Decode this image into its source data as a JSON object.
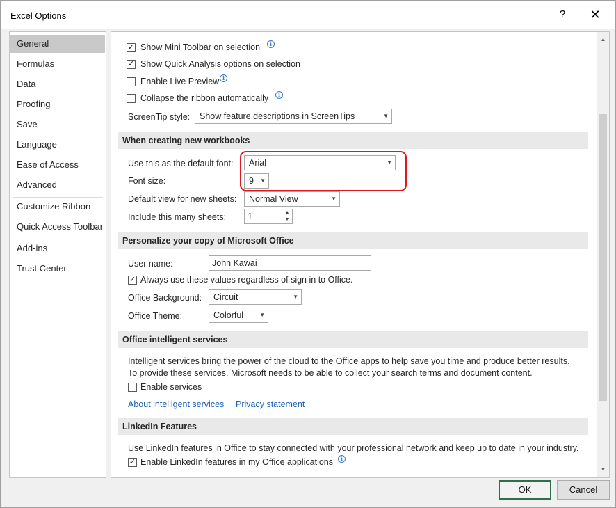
{
  "window": {
    "title": "Excel Options",
    "help_glyph": "?",
    "close_glyph": "✕"
  },
  "nav": {
    "items": [
      {
        "label": "General"
      },
      {
        "label": "Formulas"
      },
      {
        "label": "Data"
      },
      {
        "label": "Proofing"
      },
      {
        "label": "Save"
      },
      {
        "label": "Language"
      },
      {
        "label": "Ease of Access"
      },
      {
        "label": "Advanced"
      },
      {
        "label": "Customize Ribbon"
      },
      {
        "label": "Quick Access Toolbar"
      },
      {
        "label": "Add-ins"
      },
      {
        "label": "Trust Center"
      }
    ],
    "selected": "General"
  },
  "ui_options": {
    "mini_toolbar": {
      "label": "Show Mini Toolbar on selection",
      "checked": true
    },
    "quick_analysis": {
      "label": "Show Quick Analysis options on selection",
      "checked": true
    },
    "live_preview": {
      "label": "Enable Live Preview",
      "checked": false
    },
    "collapse_ribbon": {
      "label": "Collapse the ribbon automatically",
      "checked": false
    },
    "screentip": {
      "label": "ScreenTip style:",
      "value": "Show feature descriptions in ScreenTips"
    }
  },
  "new_workbooks": {
    "header": "When creating new workbooks",
    "default_font_label": "Use this as the default font:",
    "default_font_value": "Arial",
    "font_size_label": "Font size:",
    "font_size_value": "9",
    "default_view_label": "Default view for new sheets:",
    "default_view_value": "Normal View",
    "sheets_label": "Include this many sheets:",
    "sheets_value": "1"
  },
  "personalize": {
    "header": "Personalize your copy of Microsoft Office",
    "user_name_label": "User name:",
    "user_name_value": "John Kawai",
    "always_use": {
      "label": "Always use these values regardless of sign in to Office.",
      "checked": true
    },
    "background_label": "Office Background:",
    "background_value": "Circuit",
    "theme_label": "Office Theme:",
    "theme_value": "Colorful"
  },
  "intelligent": {
    "header": "Office intelligent services",
    "desc_line1": "Intelligent services bring the power of the cloud to the Office apps to help save you time and produce better results.",
    "desc_line2": "To provide these services, Microsoft needs to be able to collect your search terms and document content.",
    "enable": {
      "label": "Enable services",
      "checked": false
    },
    "about_link": "About intelligent services",
    "privacy_link": "Privacy statement"
  },
  "linkedin": {
    "header": "LinkedIn Features",
    "desc": "Use LinkedIn features in Office to stay connected with your professional network and keep up to date in your industry.",
    "enable": {
      "label": "Enable LinkedIn features in my Office applications",
      "checked": true
    }
  },
  "footer": {
    "ok_label": "OK",
    "cancel_label": "Cancel"
  },
  "colors": {
    "highlight": "#e3161b",
    "link": "#1a5fb4",
    "selected_nav": "#c9c9c9"
  }
}
